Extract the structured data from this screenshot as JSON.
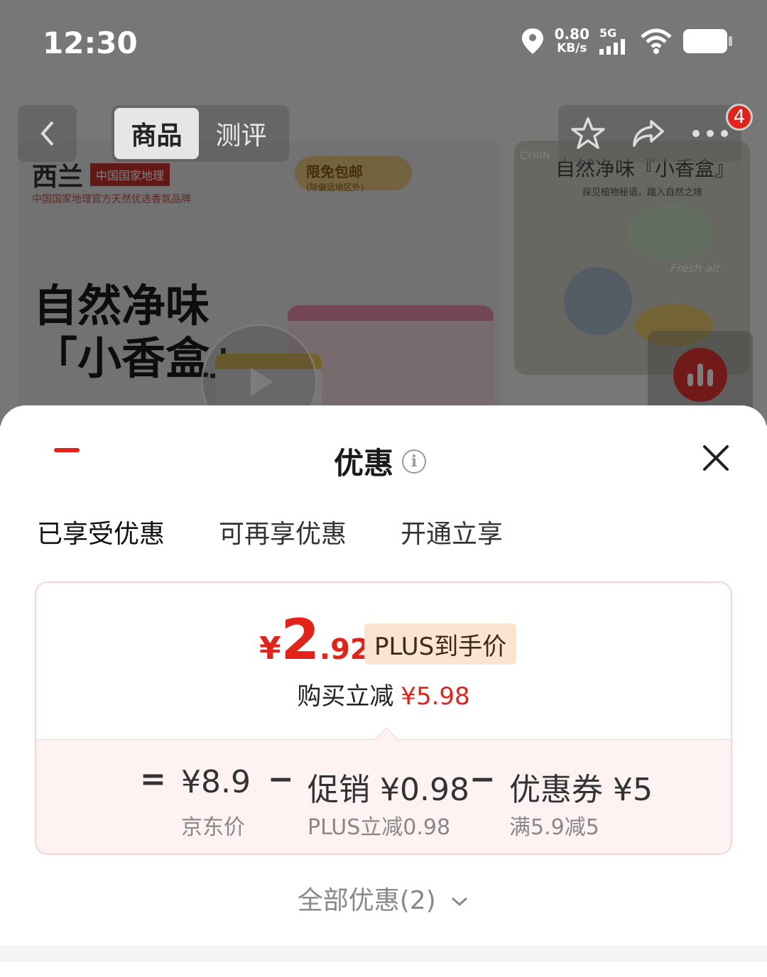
{
  "status_bar": {
    "time": "12:30",
    "net_speed_value": "0.80",
    "net_speed_unit": "KB/s",
    "network": "5G"
  },
  "nav": {
    "tabs": [
      "商品",
      "测评"
    ],
    "cart_badge": "4"
  },
  "background": {
    "brand": "西兰",
    "brand_partner": "中国国家地理",
    "brand_tagline": "中国国家地理官方天然优选香氛品牌",
    "shipping_tag": "限免包邮",
    "shipping_note": "(除偏远地区外)",
    "hero_line1": "自然净味",
    "hero_line2": "「小香盒」",
    "side_brand": "CYRIN",
    "side_title": "自然净味『小香盒』",
    "side_subtitle": "探见植物秘语，踏入自然之境",
    "side_script": "Fresh air"
  },
  "sheet": {
    "title": "优惠",
    "tabs": [
      "已享受优惠",
      "可再享优惠",
      "开通立享"
    ],
    "price": {
      "currency": "¥",
      "integer": "2",
      "decimal": ".92",
      "badge": "PLUS到手价",
      "save_label": "购买立减",
      "save_value": "¥5.98"
    },
    "breakdown": {
      "equals": "=",
      "jd_price": "¥8.9",
      "jd_price_label": "京东价",
      "minus1": "−",
      "promo": "促销 ¥0.98",
      "promo_label": "PLUS立减0.98",
      "minus2": "−",
      "coupon": "优惠券 ¥5",
      "coupon_label": "满5.9减5"
    },
    "all_offers": "全部优惠(2)"
  },
  "colors": {
    "accent": "#e2231a",
    "badge_bg": "#fde4d2",
    "card_border": "#f6d3d8",
    "breakdown_bg": "#fef2f3"
  }
}
